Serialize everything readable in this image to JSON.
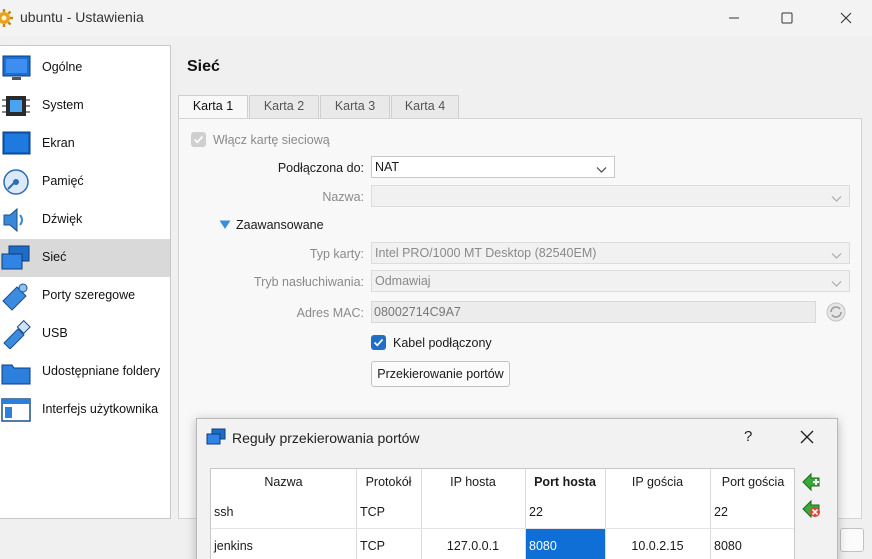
{
  "window": {
    "title": "ubuntu - Ustawienia"
  },
  "sidebar": {
    "items": [
      {
        "label": "Ogólne",
        "icon": "general-monitor-icon"
      },
      {
        "label": "System",
        "icon": "chip-icon"
      },
      {
        "label": "Ekran",
        "icon": "display-icon"
      },
      {
        "label": "Pamięć",
        "icon": "storage-disk-icon"
      },
      {
        "label": "Dźwięk",
        "icon": "speaker-icon"
      },
      {
        "label": "Sieć",
        "icon": "network-icon",
        "selected": true
      },
      {
        "label": "Porty szeregowe",
        "icon": "serial-port-icon"
      },
      {
        "label": "USB",
        "icon": "usb-icon"
      },
      {
        "label": "Udostępniane foldery",
        "icon": "shared-folder-icon"
      },
      {
        "label": "Interfejs użytkownika",
        "icon": "user-interface-icon"
      }
    ]
  },
  "main": {
    "section_title": "Sieć",
    "tabs": [
      {
        "label": "Karta 1",
        "active": true
      },
      {
        "label": "Karta 2"
      },
      {
        "label": "Karta 3"
      },
      {
        "label": "Karta 4"
      }
    ],
    "enable_adapter_label": "Włącz kartę sieciową",
    "attached_to_label": "Podłączona do:",
    "attached_to_value": "NAT",
    "name_label": "Nazwa:",
    "name_value": "",
    "advanced_label": "Zaawansowane",
    "adapter_type_label": "Typ karty:",
    "adapter_type_value": "Intel PRO/1000 MT Desktop (82540EM)",
    "promiscuous_label": "Tryb nasłuchiwania:",
    "promiscuous_value": "Odmawiaj",
    "mac_label": "Adres MAC:",
    "mac_value": "08002714C9A7",
    "cable_label": "Kabel podłączony",
    "port_forwarding_button": "Przekierowanie portów"
  },
  "dialog": {
    "title": "Reguły przekierowania portów",
    "help": "?",
    "columns": [
      "Nazwa",
      "Protokół",
      "IP hosta",
      "Port hosta",
      "IP gościa",
      "Port gościa"
    ],
    "rows": [
      [
        "ssh",
        "TCP",
        "",
        "22",
        "",
        "22"
      ],
      [
        "jenkins",
        "TCP",
        "127.0.0.1",
        "8080",
        "10.0.2.15",
        "8080"
      ]
    ]
  },
  "colors": {
    "accent": "#1f6fc9",
    "selection": "#0f6fd6",
    "sidebar_selected": "#d9d9d9"
  }
}
